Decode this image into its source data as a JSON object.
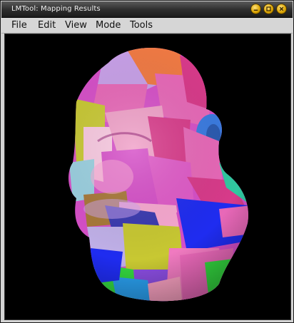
{
  "window": {
    "title": "LMTool: Mapping Results",
    "buttons": [
      "minimize",
      "maximize",
      "close"
    ]
  },
  "menubar": {
    "items": [
      {
        "label": "File"
      },
      {
        "label": "Edit"
      },
      {
        "label": "View"
      },
      {
        "label": "Mode"
      },
      {
        "label": "Tools"
      }
    ]
  },
  "viewport": {
    "background": "#000000",
    "content": "3d-mesh-face-segmented",
    "segment_colors": [
      "#e868b8",
      "#f07a44",
      "#3a7be0",
      "#d64fc8",
      "#c8c832",
      "#2aa0f0",
      "#34d840",
      "#8a4de0",
      "#d83a8a",
      "#1f2cf0",
      "#f8a8d0",
      "#c0b0e8",
      "#9ad0e0",
      "#30c8a0",
      "#a87838"
    ]
  }
}
